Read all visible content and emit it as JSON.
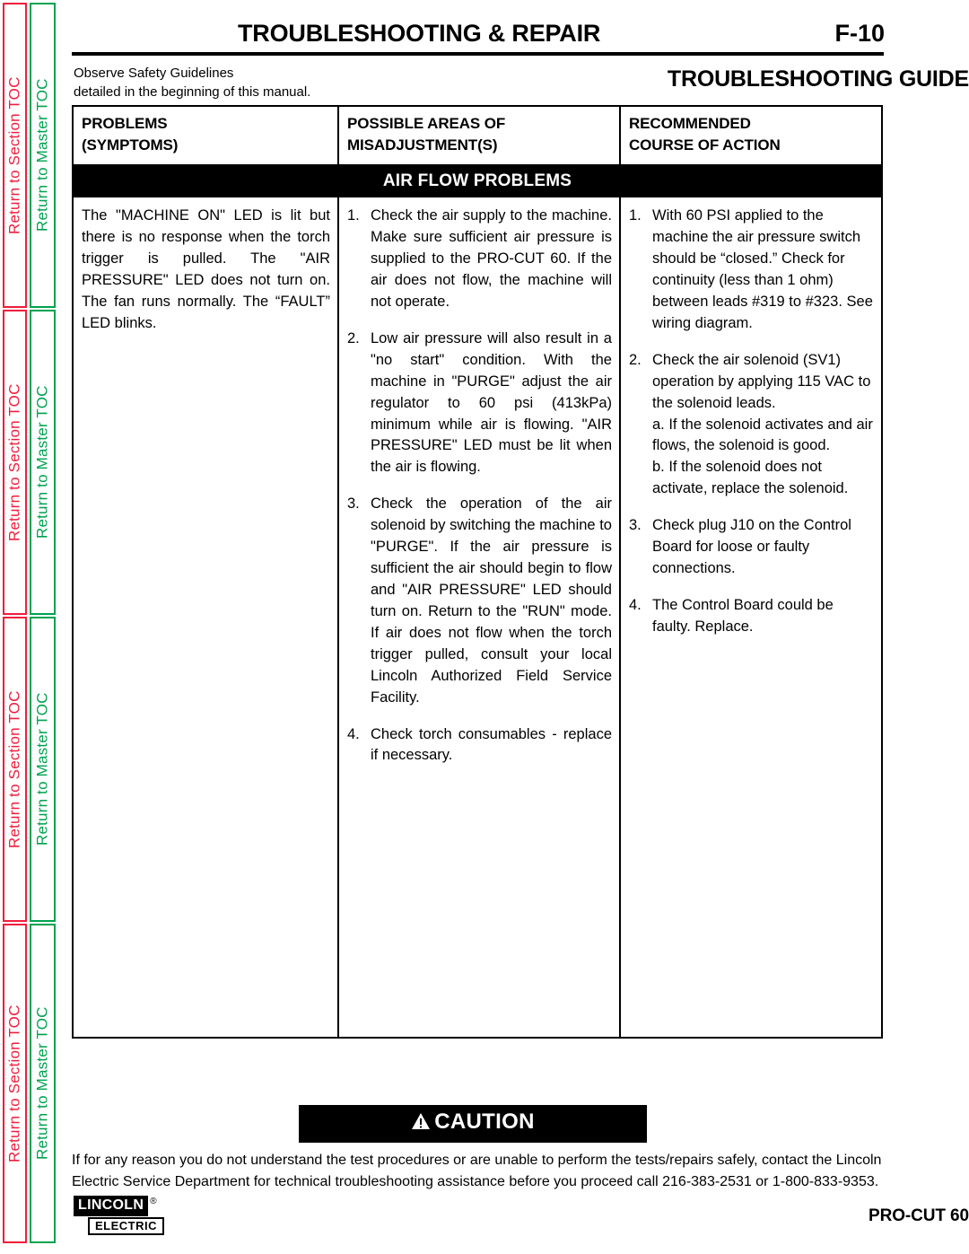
{
  "sidebar": {
    "tabs": [
      {
        "label": "Return to Section TOC",
        "color": "#f01e3c",
        "kind": "section"
      },
      {
        "label": "Return to Master TOC",
        "color": "#00a251",
        "kind": "master"
      },
      {
        "label": "Return to Section TOC",
        "color": "#f01e3c",
        "kind": "section"
      },
      {
        "label": "Return to Master TOC",
        "color": "#00a251",
        "kind": "master"
      },
      {
        "label": "Return to Section TOC",
        "color": "#f01e3c",
        "kind": "section"
      },
      {
        "label": "Return to Master TOC",
        "color": "#00a251",
        "kind": "master"
      },
      {
        "label": "Return to Section TOC",
        "color": "#f01e3c",
        "kind": "section"
      },
      {
        "label": "Return to Master TOC",
        "color": "#00a251",
        "kind": "master"
      }
    ]
  },
  "header": {
    "title": "TROUBLESHOOTING & REPAIR",
    "page_number": "F-10",
    "safety_note_line1": "Observe Safety Guidelines",
    "safety_note_line2": "detailed in the beginning of this manual.",
    "guide_title": "TROUBLESHOOTING GUIDE"
  },
  "table": {
    "headers": {
      "col1_line1": "PROBLEMS",
      "col1_line2": "(SYMPTOMS)",
      "col2_line1": "POSSIBLE AREAS OF",
      "col2_line2": "MISADJUSTMENT(S)",
      "col3_line1": "RECOMMENDED",
      "col3_line2": "COURSE OF ACTION"
    },
    "section_band": "AIR FLOW PROBLEMS",
    "symptom": "The \"MACHINE ON\" LED is lit but there is no response when the torch trigger is pulled.  The \"AIR PRESSURE\" LED does not turn on.  The fan runs normally.  The “FAULT” LED blinks.",
    "misadjustments": [
      {
        "num": "1.",
        "text": "Check the air supply to the machine.  Make sure sufficient air pressure is supplied to the PRO-CUT 60.  If the air does not flow, the machine will not operate."
      },
      {
        "num": "2.",
        "text": "Low air pressure will also result in a \"no start\" condition.  With the machine in \"PURGE\" adjust the air regulator to 60 psi (413kPa) minimum while air is flowing. \"AIR PRESSURE\" LED must be lit when the air is flowing."
      },
      {
        "num": "3.",
        "text": "Check the operation of the air solenoid by switching the machine to \"PURGE\".  If the air pressure is sufficient the air should begin to flow and \"AIR PRESSURE\" LED should turn on.  Return to the \"RUN\" mode.  If air does not flow when the torch trigger pulled, consult your local Lincoln Authorized Field Service Facility."
      },
      {
        "num": "4.",
        "text": "Check torch consumables - replace if necessary."
      }
    ],
    "actions": [
      {
        "num": "1.",
        "text": "With 60 PSI applied to the machine the air pressure switch should be “closed.” Check for continuity (less than 1 ohm) between leads #319 to #323. See wiring diagram.",
        "subs": []
      },
      {
        "num": "2.",
        "text": "Check the air solenoid (SV1) operation by applying 115 VAC to the solenoid leads.",
        "subs": [
          "a.  If the solenoid activates and air flows, the solenoid is good.",
          "b.  If the solenoid does not activate, replace the solenoid."
        ]
      },
      {
        "num": "3.",
        "text": "Check plug J10 on the Control Board for loose or faulty connections.",
        "subs": []
      },
      {
        "num": "4.",
        "text": "The Control Board could be faulty.  Replace.",
        "subs": []
      }
    ]
  },
  "caution": {
    "label": "CAUTION",
    "body": "If for any reason you do not understand the test procedures or are unable to perform the tests/repairs safely, contact the Lincoln Electric Service Department for technical troubleshooting assistance before you proceed call 216-383-2531 or 1-800-833-9353."
  },
  "footer": {
    "logo_primary": "LINCOLN",
    "logo_registered": "®",
    "logo_secondary": "ELECTRIC",
    "model": "PRO-CUT 60"
  }
}
